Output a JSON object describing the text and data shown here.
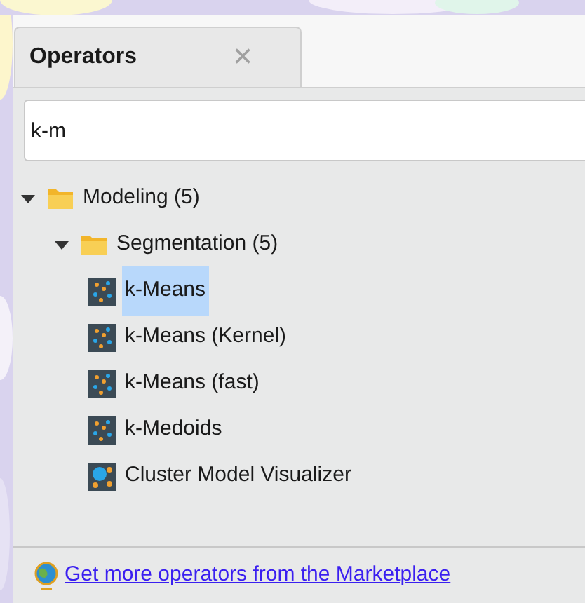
{
  "tab": {
    "label": "Operators",
    "selected": true,
    "close": "×"
  },
  "search": {
    "value": "k-m"
  },
  "tree": [
    {
      "kind": "folder",
      "label": "Modeling (5)",
      "expanded": true,
      "selected": false,
      "children": [
        {
          "kind": "folder",
          "label": "Segmentation (5)",
          "expanded": true,
          "selected": false,
          "children": [
            {
              "kind": "operator",
              "label": "k-Means",
              "selected": true
            },
            {
              "kind": "operator",
              "label": "k-Means (Kernel)",
              "selected": false
            },
            {
              "kind": "operator",
              "label": "k-Means (fast)",
              "selected": false
            },
            {
              "kind": "operator",
              "label": "k-Medoids",
              "selected": false
            },
            {
              "kind": "visualizer",
              "label": "Cluster Model Visualizer",
              "selected": false
            }
          ]
        }
      ]
    }
  ],
  "footer_link": "Get more operators from the Marketplace"
}
